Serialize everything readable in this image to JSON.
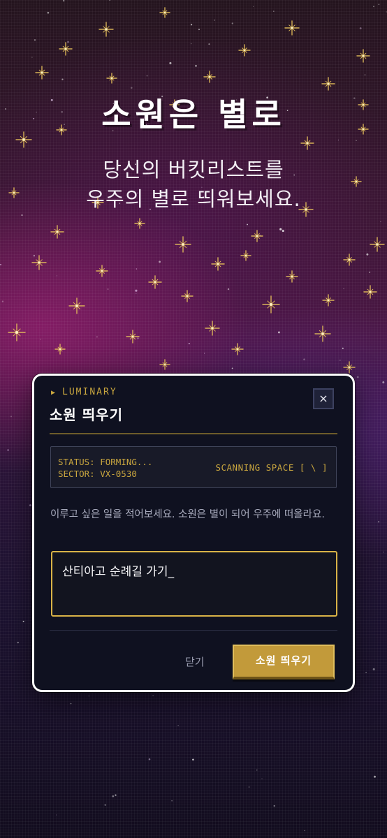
{
  "hero": {
    "title": "소원은 별로",
    "subtitle_line1": "당신의 버킷리스트를",
    "subtitle_line2": "우주의 별로 띄워보세요."
  },
  "modal": {
    "brand": "LUMINARY",
    "brand_marker": "▶",
    "title": "소원 띄우기",
    "close_icon": "×",
    "status": {
      "line1": "STATUS: FORMING...",
      "line2": "SECTOR: VX-0530",
      "scanning": "SCANNING SPACE [ \\ ]"
    },
    "description": "이루고 싶은 일을 적어보세요. 소원은 별이 되어 우주에 떠올라요.",
    "input": {
      "value": "산티아고 순례길 가기_"
    },
    "close_label": "닫기",
    "submit_label": "소원 띄우기"
  },
  "theme": {
    "accent_gold": "#c29a3a",
    "panel_bg": "#0f1120",
    "star_color": "#e8c25a"
  }
}
